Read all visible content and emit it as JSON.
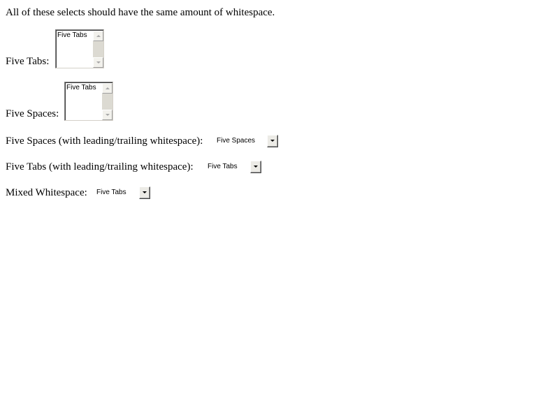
{
  "intro": "All of these selects should have the same amount of whitespace.",
  "rows": [
    {
      "label": "Five Tabs:",
      "kind": "listbox",
      "option": "Five Tabs"
    },
    {
      "label": "Five Spaces:",
      "kind": "listbox",
      "option": "Five Tabs"
    },
    {
      "label": "Five Spaces (with leading/trailing whitespace):",
      "kind": "dropdown",
      "selected": "Five Spaces"
    },
    {
      "label": "Five Tabs (with leading/trailing whitespace):",
      "kind": "dropdown",
      "selected": "Five Tabs"
    },
    {
      "label": "Mixed Whitespace:",
      "kind": "dropdown",
      "selected": "Five Tabs"
    }
  ],
  "icons": {
    "listbox_scroll_up": "chevron-up-icon",
    "listbox_scroll_down": "chevron-down-icon",
    "dropdown_arrow": "chevron-down-icon"
  }
}
